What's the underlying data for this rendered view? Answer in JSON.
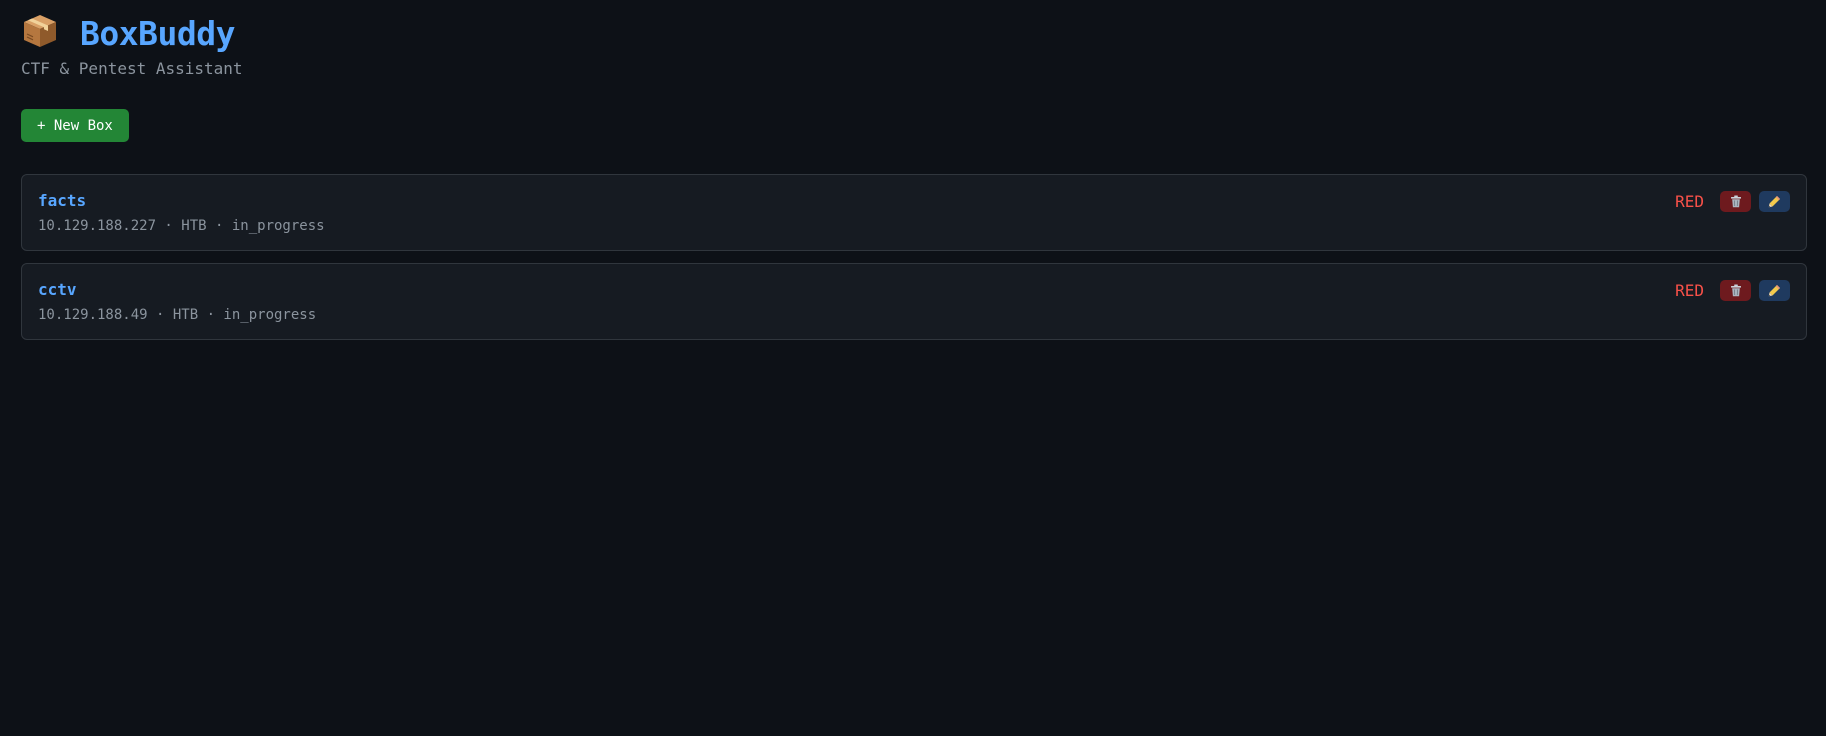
{
  "header": {
    "logo_icon": "package-icon",
    "title": "BoxBuddy",
    "subtitle": "CTF & Pentest Assistant"
  },
  "toolbar": {
    "new_box_label": "+ New Box"
  },
  "colors": {
    "background": "#0d1117",
    "card": "#161b22",
    "accent_blue": "#58a6ff",
    "green_button": "#238636",
    "red_team": "#f85149",
    "delete_bg": "#6e1a1e",
    "edit_bg": "#1f3a5f"
  },
  "boxes": [
    {
      "name": "facts",
      "meta": "10.129.188.227 · HTB · in_progress",
      "team": "RED",
      "delete_icon": "trash-icon",
      "edit_icon": "pencil-icon"
    },
    {
      "name": "cctv",
      "meta": "10.129.188.49 · HTB · in_progress",
      "team": "RED",
      "delete_icon": "trash-icon",
      "edit_icon": "pencil-icon"
    }
  ]
}
